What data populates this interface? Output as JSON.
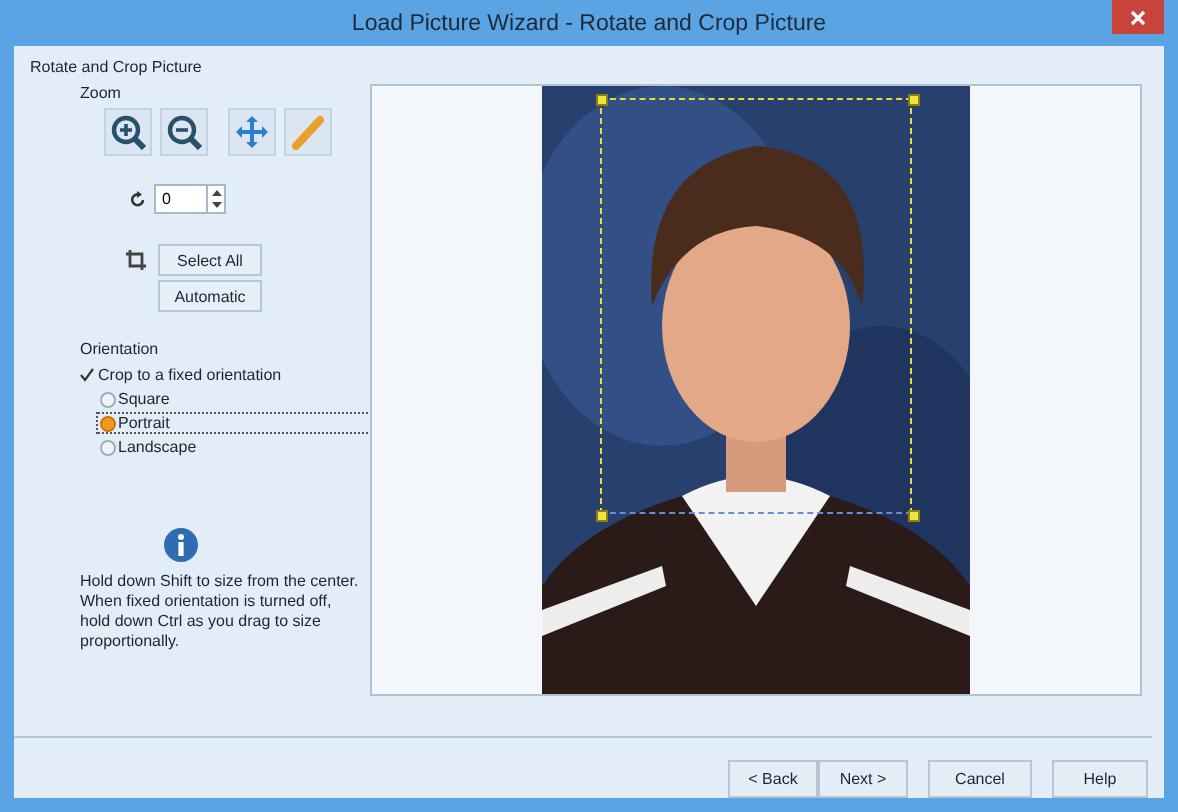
{
  "window": {
    "title": "Load Picture Wizard - Rotate and Crop Picture"
  },
  "panel": {
    "heading": "Rotate and Crop Picture",
    "zoom_label": "Zoom",
    "rotation_value": "0",
    "crop_buttons": [
      "Select All",
      "Automatic"
    ],
    "orientation": {
      "label": "Orientation",
      "fixed": {
        "label": "Crop to a fixed orientation",
        "checked": true
      },
      "options": [
        {
          "label": "Square",
          "selected": false
        },
        {
          "label": "Portrait",
          "selected": true
        },
        {
          "label": "Landscape",
          "selected": false
        }
      ]
    },
    "hint": "Hold down Shift to size from the center. When fixed orientation is turned off, hold down Ctrl as you drag to size proportionally."
  },
  "buttons": [
    "< Back",
    "Next >",
    "Cancel",
    "Help"
  ]
}
